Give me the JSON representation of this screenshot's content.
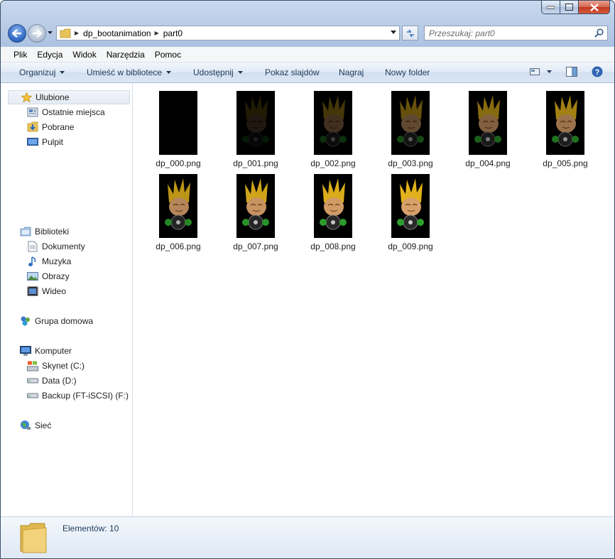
{
  "window": {
    "caption_buttons": [
      "minimize",
      "maximize",
      "close"
    ]
  },
  "address": {
    "crumbs": [
      "dp_bootanimation",
      "part0"
    ]
  },
  "search": {
    "placeholder": "Przeszukaj: part0"
  },
  "menu": [
    "Plik",
    "Edycja",
    "Widok",
    "Narzędzia",
    "Pomoc"
  ],
  "commands": {
    "organize": "Organizuj",
    "library": "Umieść w bibliotece",
    "share": "Udostępnij",
    "slideshow": "Pokaz slajdów",
    "burn": "Nagraj",
    "new_folder": "Nowy folder"
  },
  "nav": {
    "favorites": "Ulubione",
    "recent": "Ostatnie miejsca",
    "downloads": "Pobrane",
    "desktop": "Pulpit",
    "libraries": "Biblioteki",
    "documents": "Dokumenty",
    "music": "Muzyka",
    "pictures": "Obrazy",
    "video": "Wideo",
    "homegroup": "Grupa domowa",
    "computer": "Komputer",
    "drive_c": "Skynet (C:)",
    "drive_d": "Data (D:)",
    "drive_f": "Backup (FT-iSCSI) (F:)",
    "network": "Sieć"
  },
  "files": [
    {
      "name": "dp_000.png",
      "opacity": 0.0
    },
    {
      "name": "dp_001.png",
      "opacity": 0.15
    },
    {
      "name": "dp_002.png",
      "opacity": 0.3
    },
    {
      "name": "dp_003.png",
      "opacity": 0.45
    },
    {
      "name": "dp_004.png",
      "opacity": 0.6
    },
    {
      "name": "dp_005.png",
      "opacity": 0.72
    },
    {
      "name": "dp_006.png",
      "opacity": 0.84
    },
    {
      "name": "dp_007.png",
      "opacity": 0.92
    },
    {
      "name": "dp_008.png",
      "opacity": 0.97
    },
    {
      "name": "dp_009.png",
      "opacity": 1.0
    }
  ],
  "details": {
    "count": "Elementów: 10"
  }
}
